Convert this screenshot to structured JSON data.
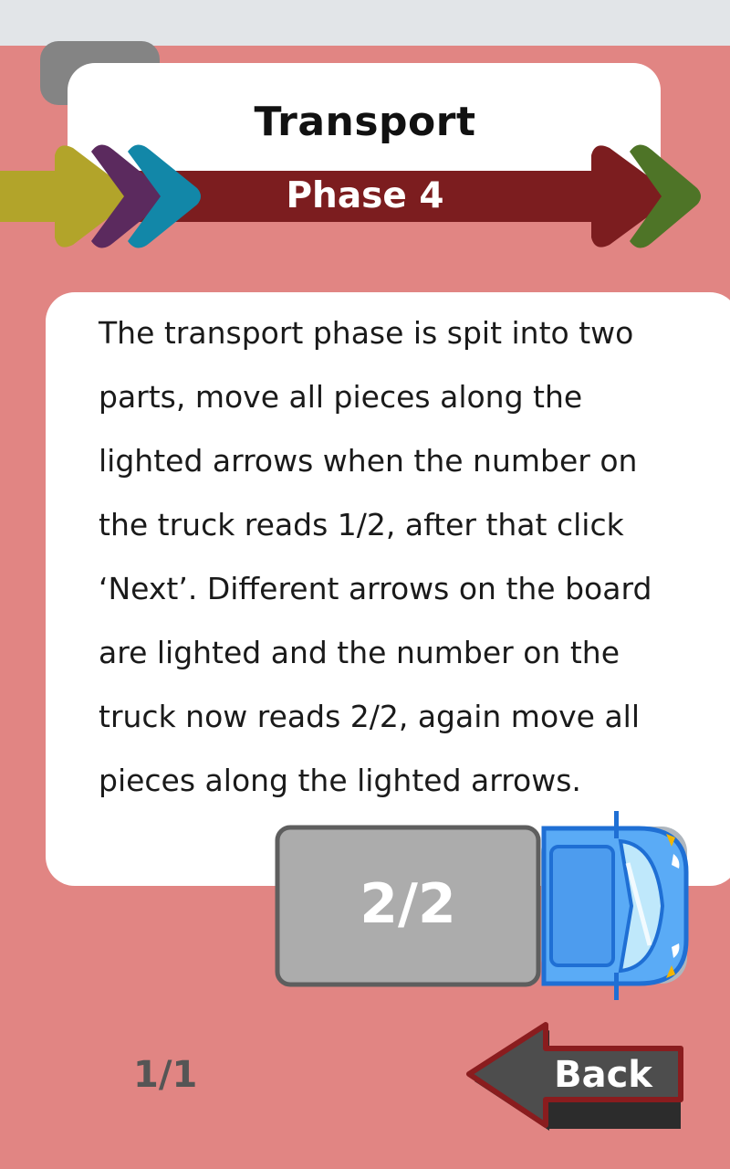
{
  "header": {
    "title": "Transport",
    "phase": "Phase 4"
  },
  "content": {
    "paragraph": "The transport phase is spit into two parts, move all pieces along the lighted arrows when the number on the truck reads 1/2, after that click ‘Next’. Different arrows on the board are lighted and the number on the truck now reads 2/2, again move all pieces along the lighted arrows."
  },
  "truck": {
    "count": "2/2",
    "icon": "truck-icon"
  },
  "footer": {
    "page_indicator": "1/1",
    "back_label": "Back"
  },
  "colors": {
    "background": "#e18583",
    "banner": "#7c1d1f",
    "chevron_yellow": "#b2a42a",
    "chevron_purple": "#5b2a5e",
    "chevron_teal": "#1287a8",
    "chevron_green": "#4e7427",
    "truck_blue": "#5aabf6",
    "cargo_gray": "#acacac"
  }
}
